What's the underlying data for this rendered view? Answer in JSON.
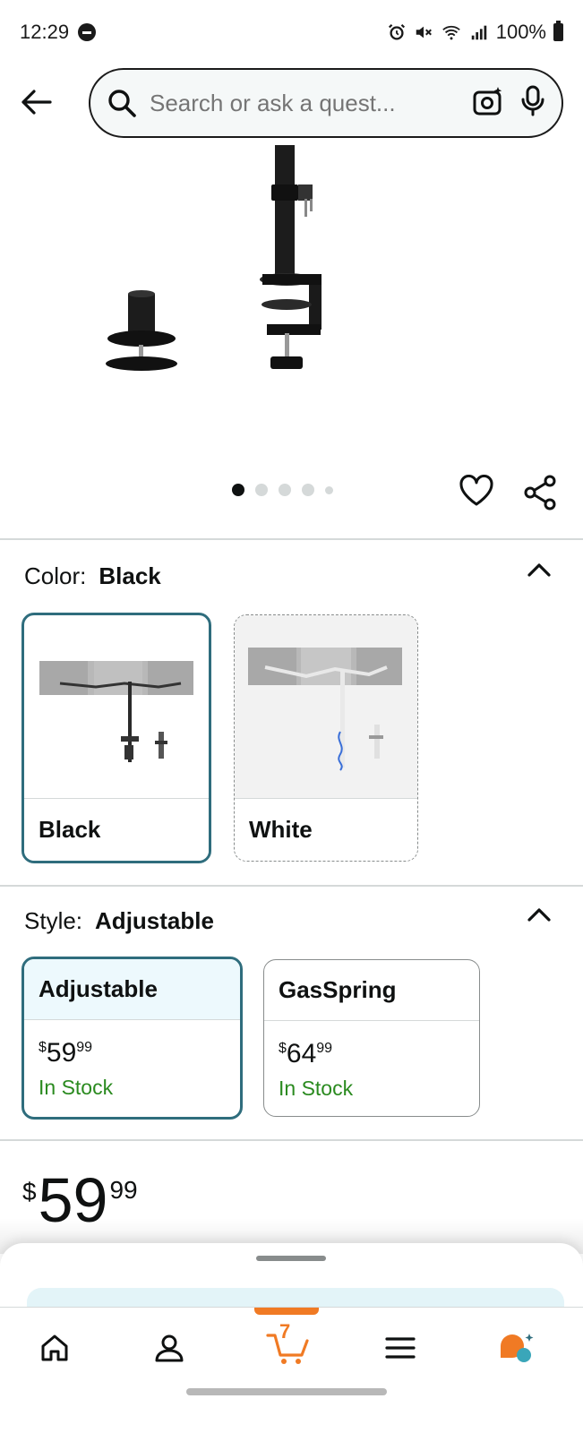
{
  "status_bar": {
    "time": "12:29",
    "battery": "100%"
  },
  "search": {
    "placeholder": "Search or ask a quest..."
  },
  "carousel": {
    "total": 5,
    "active_index": 0
  },
  "color": {
    "label": "Color:",
    "value": "Black",
    "options": [
      {
        "name": "Black",
        "selected": true
      },
      {
        "name": "White",
        "selected": false
      }
    ]
  },
  "style": {
    "label": "Style:",
    "value": "Adjustable",
    "options": [
      {
        "name": "Adjustable",
        "currency": "$",
        "whole": "59",
        "fraction": "99",
        "stock": "In Stock",
        "selected": true
      },
      {
        "name": "GasSpring",
        "currency": "$",
        "whole": "64",
        "fraction": "99",
        "stock": "In Stock",
        "selected": false
      }
    ]
  },
  "price": {
    "currency": "$",
    "whole": "59",
    "fraction": "99"
  },
  "nav": {
    "cart_count": "7"
  },
  "colors": {
    "accent": "#2f6d7d",
    "in_stock": "#2a8a1f",
    "cart": "#f07a24"
  }
}
